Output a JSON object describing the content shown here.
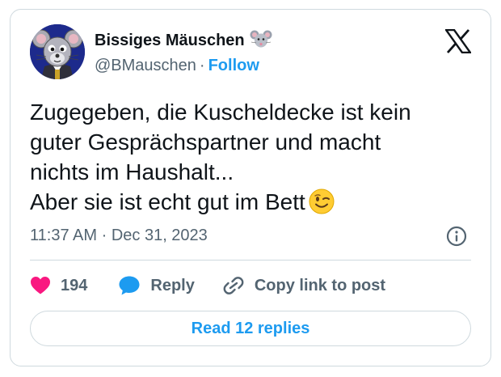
{
  "author": {
    "name": "Bissiges Mäuschen",
    "name_emoji": "mouse-face-emoji",
    "handle": "@BMauschen",
    "separator": "·",
    "follow_label": "Follow",
    "avatar": "cartoon-mouse-avatar"
  },
  "brand": {
    "logo": "x-logo"
  },
  "tweet": {
    "lines": [
      "Zugegeben, die Kuscheldecke ist kein",
      "guter Gesprächspartner und macht",
      "nichts im Haushalt...",
      "Aber sie ist echt gut im Bett"
    ],
    "trailing_emoji": "winking-face-emoji"
  },
  "meta": {
    "time": "11:37 AM",
    "separator": "·",
    "date": "Dec 31, 2023",
    "info_icon": "info-icon"
  },
  "actions": {
    "likes_count": "194",
    "reply_label": "Reply",
    "copy_label": "Copy link to post"
  },
  "replies_button": {
    "label": "Read 12 replies"
  },
  "colors": {
    "accent": "#1d9bf0",
    "like": "#f91880",
    "text": "#0f1419",
    "muted": "#536471",
    "border": "#cfd9de"
  }
}
